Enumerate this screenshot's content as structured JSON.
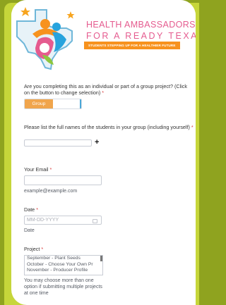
{
  "header": {
    "title_line1": "HEALTH AMBASSADORS",
    "title_line2": "FOR A READY TEXAS",
    "tagline": "STUDENTS STEPPING UP FOR A HEALTHIER FUTURE"
  },
  "group_question": {
    "label": "Are you completing this as an individual or part of a group project? (Click on the button to change selection)",
    "required": "*",
    "toggle_label": "Group"
  },
  "students": {
    "label": "Please list the full names of the students in your group (including yourself)",
    "required": "*",
    "value": "",
    "add_label": "+"
  },
  "email": {
    "label": "Your Email",
    "required": "*",
    "value": "",
    "hint": "example@example.com"
  },
  "date": {
    "label": "Date",
    "required": "*",
    "placeholder": "MM-DD-YYYY",
    "hint": "Date"
  },
  "project": {
    "label": "Project",
    "required": "*",
    "options": [
      "September - Plant Seeds",
      "October - Choose Your Own Pr",
      "November - Producer Profile"
    ],
    "hint": "You may choose more than one option if submitting multiple projects at one time"
  },
  "colors": {
    "page_bg": "#8fa31f",
    "accent_pink": "#e55b8f",
    "accent_orange": "#f7921e",
    "toggle_orange": "#f0a54c",
    "toggle_blue": "#4aa8d8"
  }
}
